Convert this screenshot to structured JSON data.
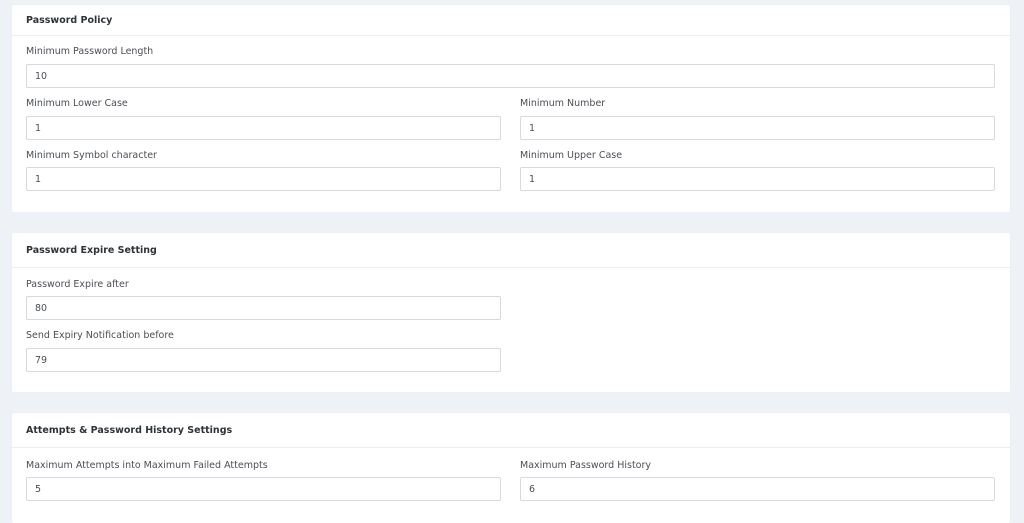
{
  "password_policy": {
    "title": "Password Policy",
    "min_length": {
      "label": "Minimum Password Length",
      "value": "10"
    },
    "min_lower": {
      "label": "Minimum Lower Case",
      "value": "1"
    },
    "min_number": {
      "label": "Minimum Number",
      "value": "1"
    },
    "min_symbol": {
      "label": "Minimum Symbol character",
      "value": "1"
    },
    "min_upper": {
      "label": "Minimum Upper Case",
      "value": "1"
    }
  },
  "password_expire": {
    "title": "Password Expire Setting",
    "expire_after": {
      "label": "Password Expire after",
      "value": "80"
    },
    "notify_before": {
      "label": "Send Expiry Notification before",
      "value": "79"
    }
  },
  "attempts_history": {
    "title": "Attempts & Password History Settings",
    "max_attempts": {
      "label": "Maximum Attempts into Maximum Failed Attempts",
      "value": "5"
    },
    "max_history": {
      "label": "Maximum Password History",
      "value": "6"
    }
  }
}
